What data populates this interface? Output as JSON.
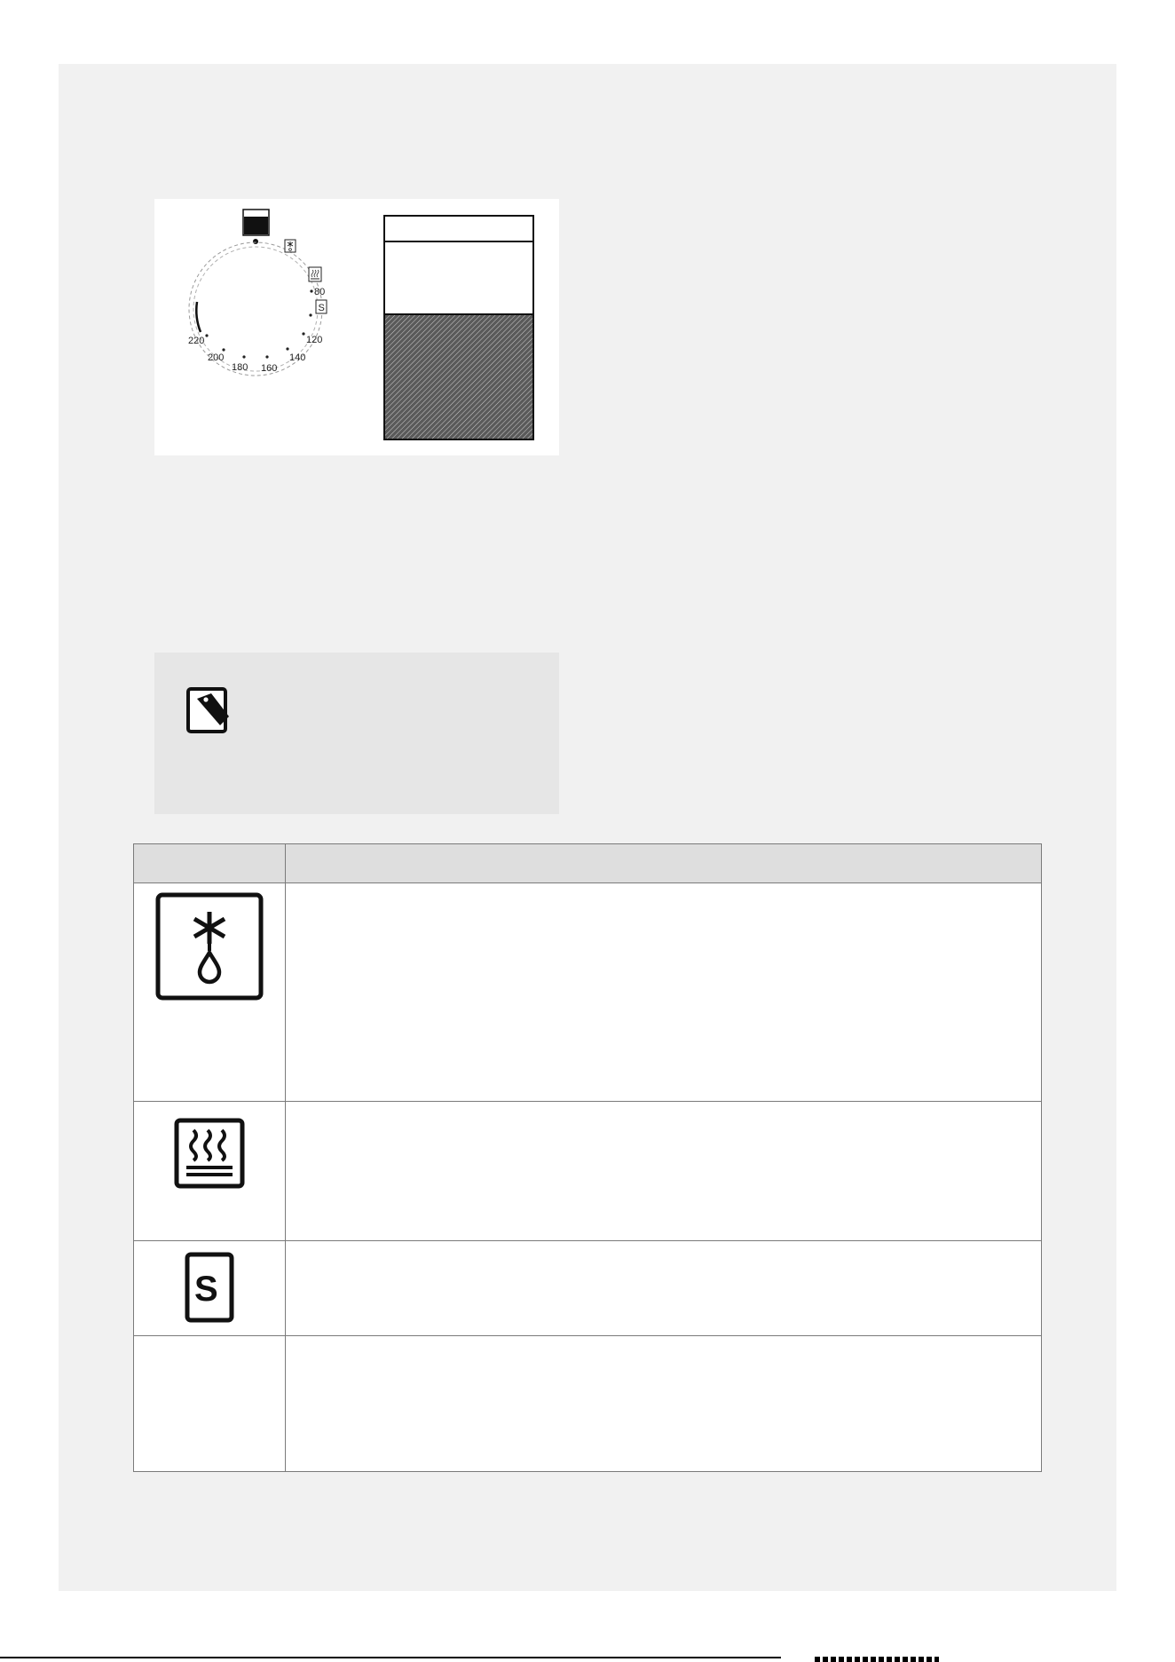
{
  "dial": {
    "temperatures": [
      "220",
      "200",
      "180",
      "160",
      "140",
      "120",
      "80"
    ],
    "symbol_labels": [
      "defrost-icon",
      "warming-icon",
      "s-mode-icon"
    ],
    "s_label": "S"
  },
  "note": {
    "icon": "note-tag-icon"
  },
  "symbol_table": {
    "headers": [
      "",
      ""
    ],
    "rows": [
      {
        "icon": "defrost-icon",
        "description": ""
      },
      {
        "icon": "warming-icon",
        "description": ""
      },
      {
        "icon": "s-mode-icon",
        "label": "S",
        "description": ""
      },
      {
        "icon": "",
        "description": ""
      }
    ]
  }
}
